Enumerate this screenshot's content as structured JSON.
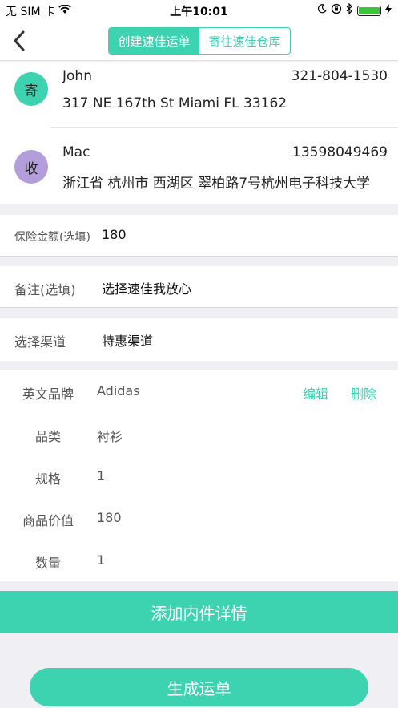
{
  "status_bar": {
    "carrier": "无 SIM 卡",
    "time": "上午10:01"
  },
  "nav": {
    "tabs": [
      {
        "label": "创建速佳运单",
        "active": true
      },
      {
        "label": "寄往速佳仓库",
        "active": false
      }
    ]
  },
  "sender": {
    "badge": "寄",
    "badge_color": "#3ed3b0",
    "name": "John",
    "phone": "321-804-1530",
    "address": "317 NE 167th St Miami FL 33162"
  },
  "receiver": {
    "badge": "收",
    "badge_color": "#b39ddb",
    "name": "Mac",
    "phone": "13598049469",
    "address": "浙江省 杭州市 西湖区 翠柏路7号杭州电子科技大学"
  },
  "insurance": {
    "label": "保险金额(选填)",
    "value": "180"
  },
  "remark": {
    "label": "备注(选填)",
    "value": "选择速佳我放心"
  },
  "channel": {
    "label": "选择渠道",
    "value": "特惠渠道"
  },
  "goods": {
    "edit_label": "编辑",
    "delete_label": "删除",
    "rows": [
      {
        "label": "英文品牌",
        "value": "Adidas"
      },
      {
        "label": "品类",
        "value": "衬衫"
      },
      {
        "label": "规格",
        "value": "1"
      },
      {
        "label": "商品价值",
        "value": "180"
      },
      {
        "label": "数量",
        "value": "1"
      }
    ]
  },
  "add_detail_label": "添加内件详情",
  "generate_label": "生成运单",
  "colors": {
    "accent": "#3ed3b0"
  }
}
